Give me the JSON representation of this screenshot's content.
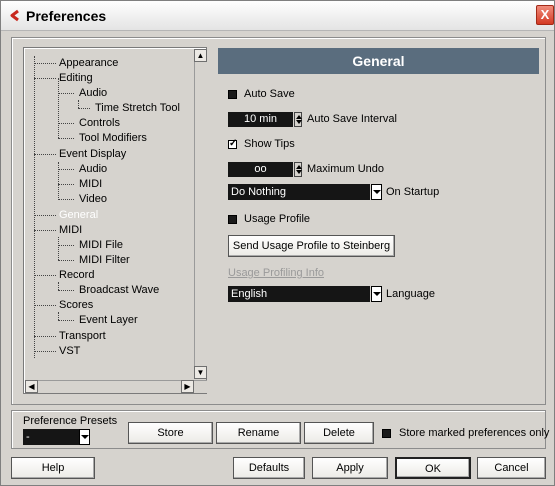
{
  "window": {
    "title": "Preferences",
    "close_glyph": "X"
  },
  "tree": {
    "items": [
      {
        "label": "Appearance"
      },
      {
        "label": "Editing"
      },
      {
        "label": "Audio"
      },
      {
        "label": "Time Stretch Tool"
      },
      {
        "label": "Controls"
      },
      {
        "label": "Tool Modifiers"
      },
      {
        "label": "Event Display"
      },
      {
        "label": "Audio"
      },
      {
        "label": "MIDI"
      },
      {
        "label": "Video"
      },
      {
        "label": "General"
      },
      {
        "label": "MIDI"
      },
      {
        "label": "MIDI File"
      },
      {
        "label": "MIDI Filter"
      },
      {
        "label": "Record"
      },
      {
        "label": "Broadcast Wave"
      },
      {
        "label": "Scores"
      },
      {
        "label": "Event Layer"
      },
      {
        "label": "Transport"
      },
      {
        "label": "VST"
      }
    ],
    "selected": "General",
    "scroll_up": "▲",
    "scroll_down": "▼",
    "scroll_left": "◀",
    "scroll_right": "▶"
  },
  "panel": {
    "title": "General",
    "auto_save": {
      "label": "Auto Save",
      "checked": false
    },
    "auto_save_interval": {
      "value": "10 min",
      "label": "Auto Save Interval"
    },
    "show_tips": {
      "label": "Show Tips",
      "checked": true
    },
    "maximum_undo": {
      "value": "oo",
      "label": "Maximum Undo"
    },
    "on_startup": {
      "value": "Do Nothing",
      "label": "On Startup"
    },
    "usage_profile": {
      "label": "Usage Profile",
      "checked": false
    },
    "send_usage_button": "Send Usage Profile to Steinberg",
    "usage_info_link": "Usage Profiling Info",
    "language": {
      "value": "English",
      "label": "Language"
    }
  },
  "presets": {
    "label": "Preference Presets",
    "value": "-",
    "store": "Store",
    "rename": "Rename",
    "delete": "Delete",
    "store_marked_label": "Store marked preferences only"
  },
  "footer": {
    "help": "Help",
    "defaults": "Defaults",
    "apply": "Apply",
    "ok": "OK",
    "cancel": "Cancel"
  },
  "colors": {
    "window_bg": "#d6d3ce",
    "header_bg": "#5a6d7e",
    "field_bg": "#151515",
    "close_red": "#d43a24",
    "logo_red": "#c8281e"
  }
}
